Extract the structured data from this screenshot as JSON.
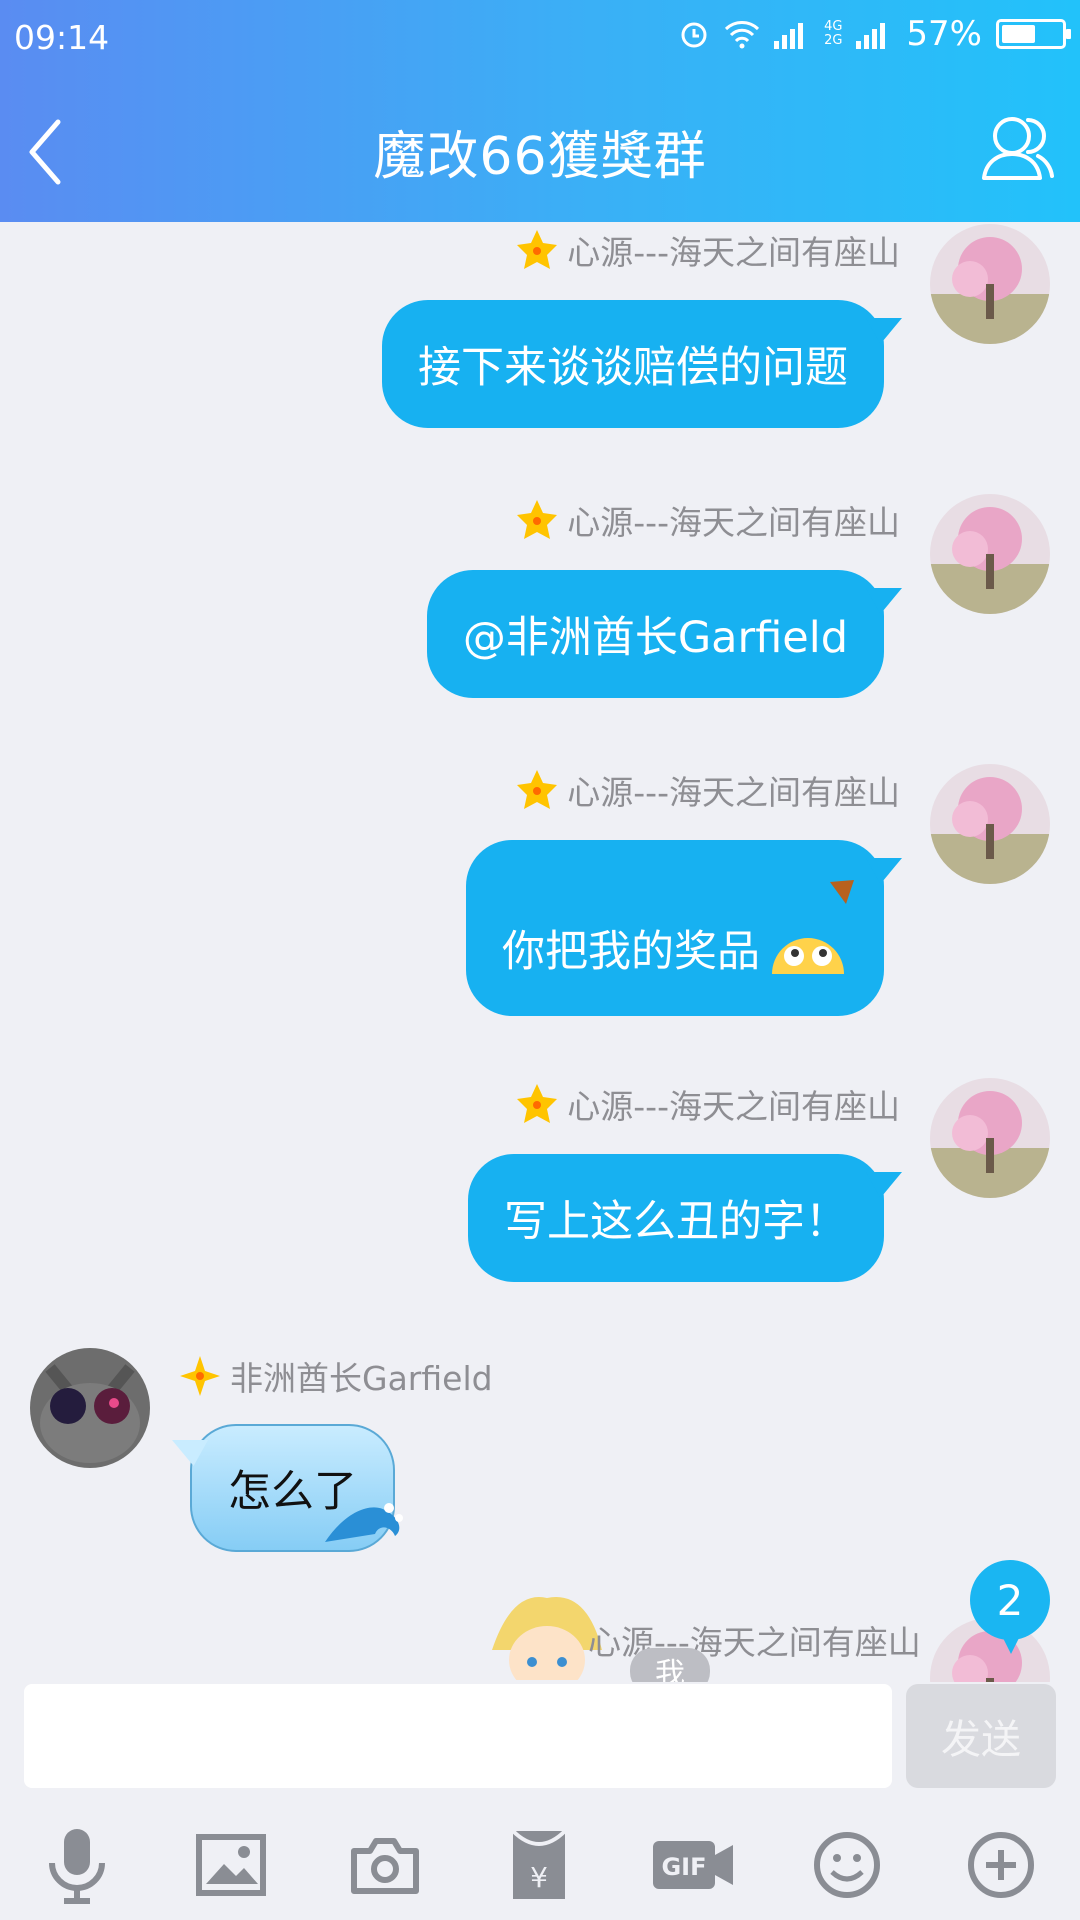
{
  "status_bar": {
    "time": "09:14",
    "battery_percent": "57%",
    "battery_level": 0.57,
    "network_top": "4G",
    "network_bottom": "2G"
  },
  "header": {
    "title": "魔改66獲獎群"
  },
  "messages": [
    {
      "side": "right",
      "nickname": "心源---海天之间有座山",
      "text": "接下来谈谈赔偿的问题"
    },
    {
      "side": "right",
      "nickname": "心源---海天之间有座山",
      "text": "@非洲酋长Garfield"
    },
    {
      "side": "right",
      "nickname": "心源---海天之间有座山",
      "text": "你把我的奖品"
    },
    {
      "side": "right",
      "nickname": "心源---海天之间有座山",
      "text": "写上这么丑的字！"
    },
    {
      "side": "left",
      "nickname": "非洲酋长Garfield",
      "text": "怎么了"
    },
    {
      "side": "right",
      "nickname": "心源---海天之间有座山",
      "tag": "我"
    }
  ],
  "unread_badge": "2",
  "input": {
    "placeholder": "",
    "send_label": "发送"
  },
  "toolbar_icons": [
    "microphone-icon",
    "image-icon",
    "camera-icon",
    "red-packet-icon",
    "gif-icon",
    "emoji-icon",
    "plus-icon"
  ],
  "colors": {
    "bubble": "#17b1f1",
    "header_start": "#5a8cf2",
    "header_end": "#22c2fa",
    "background": "#eff0f5"
  }
}
